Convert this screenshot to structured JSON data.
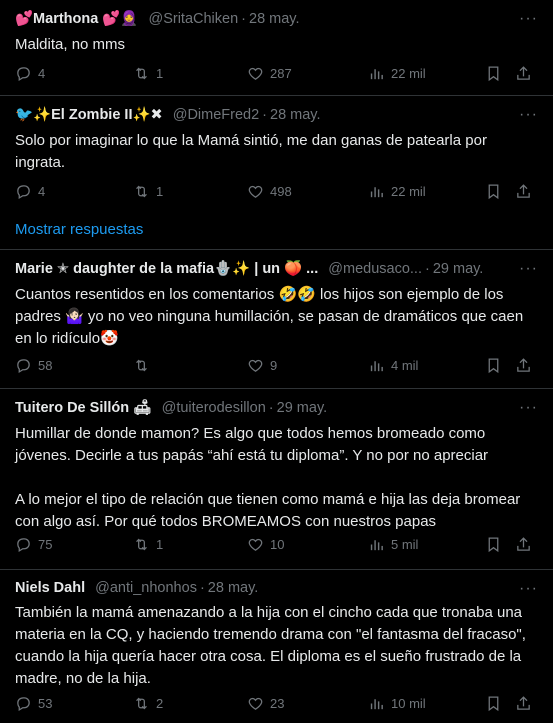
{
  "tweets": [
    {
      "name": "💕Marthona 💕🧕",
      "handle": "@SritaChiken",
      "date": "28 may.",
      "text": [
        "Maldita, no mms"
      ],
      "replies": "4",
      "retweets": "1",
      "likes": "287",
      "views": "22 mil"
    },
    {
      "name": "🐦✨El Zombie II✨✖",
      "handle": "@DimeFred2",
      "date": "28 may.",
      "text": [
        "Solo por imaginar lo que la Mamá sintió, me dan ganas de patearla por ingrata."
      ],
      "replies": "4",
      "retweets": "1",
      "likes": "498",
      "views": "22 mil",
      "show_more": "Mostrar respuestas"
    },
    {
      "name": "Marie ✭ daughter de la mafia🪬✨ | un 🍑 ...",
      "handle": "@medusaco...",
      "date": "29 may.",
      "text": [
        "Cuantos resentidos en los comentarios 🤣🤣 los hijos son ejemplo de los padres 🤷🏻‍♀️ yo no veo ninguna humillación, se pasan de dramáticos que caen en lo ridículo🤡"
      ],
      "replies": "58",
      "retweets": "",
      "likes": "9",
      "views": "4 mil"
    },
    {
      "name": "Tuitero De Sillón 🛋",
      "handle": "@tuiterodesillon",
      "date": "29 may.",
      "text": [
        "Humillar de donde mamon? Es algo que todos hemos bromeado como jóvenes. Decirle a tus papás “ahí está tu diploma”. Y no por no apreciar",
        "A lo mejor el tipo de relación que tienen como mamá e hija las deja bromear con algo así. Por qué todos BROMEAMOS con nuestros papas"
      ],
      "replies": "75",
      "retweets": "1",
      "likes": "10",
      "views": "5 mil"
    },
    {
      "name": "Niels Dahl",
      "handle": "@anti_nhonhos",
      "date": "28 may.",
      "text": [
        "También la mamá amenazando a la hija con el cincho cada que tronaba una materia en la CQ, y haciendo tremendo drama con \"el fantasma del fracaso\", cuando la hija quería hacer otra cosa. El diploma es el sueño frustrado de la madre, no de la hija."
      ],
      "replies": "53",
      "retweets": "2",
      "likes": "23",
      "views": "10 mil"
    }
  ],
  "more_icon": "more-dots-icon"
}
